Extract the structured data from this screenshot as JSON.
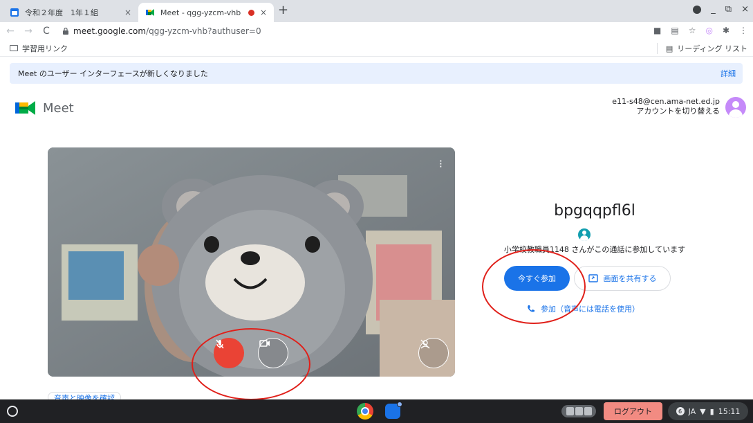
{
  "tabs": [
    {
      "title": "令和２年度　1年１組",
      "close": "×"
    },
    {
      "title": "Meet - qgg-yzcm-vhb",
      "close": "×"
    }
  ],
  "new_tab": "+",
  "window": {
    "minimize": "_",
    "restore": "⧉",
    "close": "×"
  },
  "address": {
    "host": "meet.google.com",
    "path": "/qgg-yzcm-vhb?authuser=0"
  },
  "bookmarks": {
    "folder": "学習用リンク",
    "reading_list": "リーディング リスト"
  },
  "banner": {
    "message": "Meet のユーザー インターフェースが新しくなりました",
    "details": "詳細"
  },
  "meet": {
    "product": "Meet"
  },
  "account": {
    "email": "e11-s48@cen.ama-net.ed.jp",
    "switch": "アカウントを切り替える"
  },
  "video": {
    "mic_state": "muted",
    "av_check": "音声と映像を確認"
  },
  "join": {
    "meeting_code": "bpgqqpfl6l",
    "in_call": "小学校教職員1148 さんがこの通話に参加しています",
    "join_now": "今すぐ参加",
    "present": "画面を共有する",
    "phone_join": "参加（音声には電話を使用）"
  },
  "shelf": {
    "logout": "ログアウト",
    "notification_count": "6",
    "ime": "JA",
    "time": "15:11"
  },
  "colors": {
    "accent": "#1a73e8",
    "mic_muted": "#ea4335",
    "annotation": "#e0201a",
    "logout": "#f28b82"
  }
}
